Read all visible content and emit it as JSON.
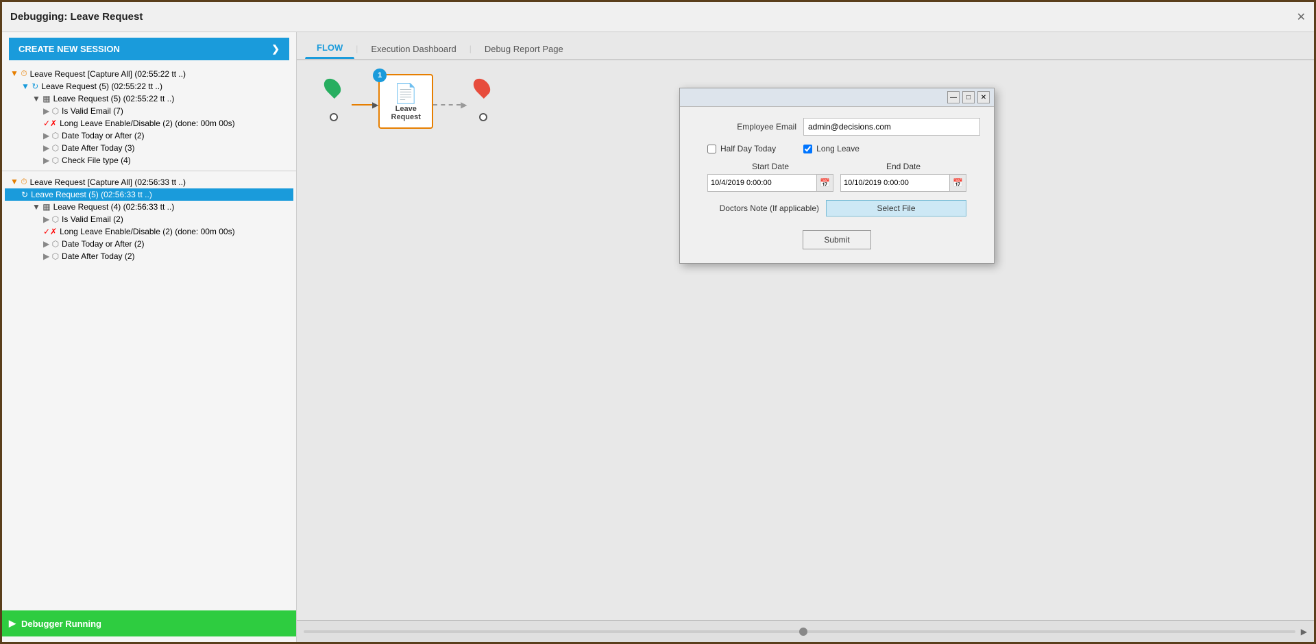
{
  "window": {
    "title": "Debugging: Leave Request",
    "close_label": "✕"
  },
  "left_panel": {
    "create_btn_label": "CREATE NEW SESSION",
    "create_btn_arrow": "❯",
    "tree": [
      {
        "id": "t1",
        "indent": 1,
        "icon": "clock",
        "label": "Leave Request [Capture All] (02:55:22 tt ..)",
        "toggle": "▼",
        "selected": false
      },
      {
        "id": "t2",
        "indent": 2,
        "icon": "sync",
        "label": "Leave Request (5) (02:55:22 tt ..)",
        "toggle": "▼",
        "selected": false
      },
      {
        "id": "t3",
        "indent": 3,
        "icon": "table",
        "label": "Leave Request (5) (02:55:22 tt ..)",
        "toggle": "▼",
        "selected": false
      },
      {
        "id": "t4",
        "indent": 4,
        "icon": "flow",
        "label": "Is Valid Email (7)",
        "toggle": "▶",
        "selected": false
      },
      {
        "id": "t5",
        "indent": 4,
        "icon": "check-x",
        "label": "Long Leave Enable/Disable (2) (done: 00m 00s)",
        "toggle": "",
        "selected": false
      },
      {
        "id": "t6",
        "indent": 4,
        "icon": "flow",
        "label": "Date Today or After (2)",
        "toggle": "▶",
        "selected": false
      },
      {
        "id": "t7",
        "indent": 4,
        "icon": "flow",
        "label": "Date After Today (3)",
        "toggle": "▶",
        "selected": false
      },
      {
        "id": "t8",
        "indent": 4,
        "icon": "flow",
        "label": "Check File type (4)",
        "toggle": "▶",
        "selected": false
      }
    ],
    "tree2": [
      {
        "id": "t9",
        "indent": 1,
        "icon": "clock",
        "label": "Leave Request [Capture All] (02:56:33 tt ..)",
        "toggle": "▼",
        "selected": false
      },
      {
        "id": "t10",
        "indent": 2,
        "icon": "sync",
        "label": "Leave Request (5) (02:56:33 tt ..)",
        "toggle": "",
        "selected": true
      },
      {
        "id": "t11",
        "indent": 3,
        "icon": "table",
        "label": "Leave Request (4) (02:56:33 tt ..)",
        "toggle": "▼",
        "selected": false
      },
      {
        "id": "t12",
        "indent": 4,
        "icon": "flow",
        "label": "Is Valid Email (2)",
        "toggle": "▶",
        "selected": false
      },
      {
        "id": "t13",
        "indent": 4,
        "icon": "check-x",
        "label": "Long Leave Enable/Disable (2) (done: 00m 00s)",
        "toggle": "",
        "selected": false
      },
      {
        "id": "t14",
        "indent": 4,
        "icon": "flow",
        "label": "Date Today or After (2)",
        "toggle": "▶",
        "selected": false
      },
      {
        "id": "t15",
        "indent": 4,
        "icon": "flow",
        "label": "Date After Today (2)",
        "toggle": "▶",
        "selected": false
      }
    ],
    "status": {
      "icon": "▶",
      "label": "Debugger Running"
    }
  },
  "right_panel": {
    "tabs": [
      {
        "id": "flow",
        "label": "FLOW",
        "active": true
      },
      {
        "id": "exec",
        "label": "Execution Dashboard",
        "active": false
      },
      {
        "id": "debug",
        "label": "Debug Report Page",
        "active": false
      }
    ],
    "flow_node": {
      "number": "1",
      "label": "Leave\nRequest"
    }
  },
  "modal": {
    "title_btn_minimize": "—",
    "title_btn_restore": "□",
    "title_btn_close": "✕",
    "fields": {
      "employee_email_label": "Employee Email",
      "employee_email_value": "admin@decisions.com",
      "half_day_label": "Half Day Today",
      "half_day_checked": false,
      "long_leave_label": "Long Leave",
      "long_leave_checked": true,
      "start_date_label": "Start Date",
      "end_date_label": "End Date",
      "start_date_value": "10/4/2019 0:00:00",
      "end_date_value": "10/10/2019 0:00:00",
      "doctors_note_label": "Doctors Note (If applicable)",
      "select_file_label": "Select File",
      "submit_label": "Submit"
    }
  },
  "bottom_bar": {
    "scroll_arrow": "▶"
  }
}
